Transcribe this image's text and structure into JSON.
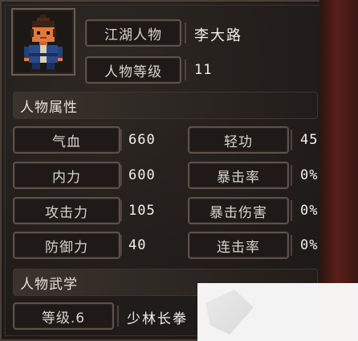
{
  "character": {
    "name_label": "江湖人物",
    "name_value": "李大路",
    "level_label": "人物等级",
    "level_value": "11"
  },
  "attributes": {
    "section_title": "人物属性",
    "rows": [
      {
        "left_label": "气血",
        "left_value": "660",
        "right_label": "轻功",
        "right_value": "45"
      },
      {
        "left_label": "内力",
        "left_value": "600",
        "right_label": "暴击率",
        "right_value": "0%"
      },
      {
        "left_label": "攻击力",
        "left_value": "105",
        "right_label": "暴击伤害",
        "right_value": "0%"
      },
      {
        "left_label": "防御力",
        "left_value": "40",
        "right_label": "连击率",
        "right_value": "0%"
      }
    ]
  },
  "martial": {
    "section_title": "人物武学",
    "level_label": "等级.6",
    "skill_name": "少林长拳"
  },
  "colors": {
    "panel_bg": "#221d1a",
    "border": "#5d524a",
    "accent_red": "#5a1e18"
  }
}
